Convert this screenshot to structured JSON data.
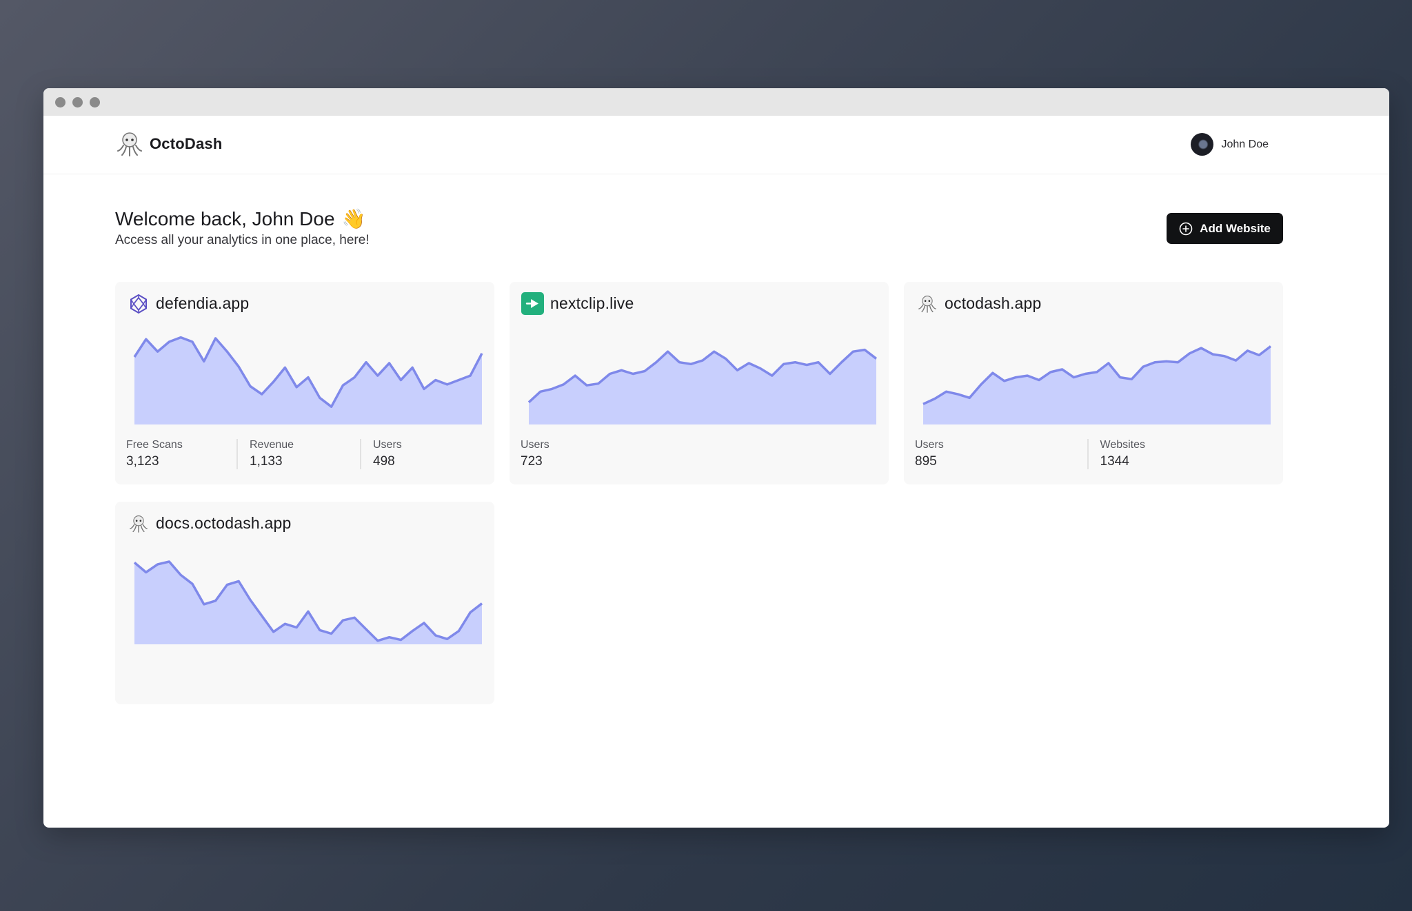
{
  "brand": {
    "name": "OctoDash",
    "logo_icon": "octopus-logo-icon"
  },
  "user": {
    "name": "John Doe"
  },
  "welcome": {
    "title": "Welcome back, John Doe",
    "emoji": "👋",
    "subtitle": "Access all your analytics in one place, here!"
  },
  "actions": {
    "add_website_label": "Add Website"
  },
  "colors": {
    "line": "#7f89ea",
    "fill": "#c8cffd",
    "card_bg": "#f8f8f8",
    "button_bg": "#111214"
  },
  "sites": [
    {
      "name": "defendia.app",
      "icon": "polyhedron-icon",
      "series": [
        0.76,
        0.96,
        0.82,
        0.93,
        0.98,
        0.93,
        0.71,
        0.97,
        0.82,
        0.65,
        0.43,
        0.34,
        0.48,
        0.64,
        0.42,
        0.53,
        0.3,
        0.2,
        0.44,
        0.53,
        0.7,
        0.55,
        0.69,
        0.5,
        0.64,
        0.4,
        0.5,
        0.45,
        0.5,
        0.55,
        0.8
      ],
      "stats": [
        {
          "label": "Free Scans",
          "value": "3,123"
        },
        {
          "label": "Revenue",
          "value": "1,133"
        },
        {
          "label": "Users",
          "value": "498"
        }
      ]
    },
    {
      "name": "nextclip.live",
      "icon": "play-tag-icon",
      "series": [
        0.25,
        0.37,
        0.4,
        0.45,
        0.55,
        0.44,
        0.46,
        0.57,
        0.61,
        0.57,
        0.6,
        0.7,
        0.82,
        0.7,
        0.68,
        0.72,
        0.82,
        0.74,
        0.61,
        0.69,
        0.63,
        0.55,
        0.68,
        0.7,
        0.67,
        0.7,
        0.57,
        0.7,
        0.82,
        0.84,
        0.74
      ],
      "stats": [
        {
          "label": "Users",
          "value": "723"
        }
      ]
    },
    {
      "name": "octodash.app",
      "icon": "octopus-icon",
      "series": [
        0.23,
        0.29,
        0.37,
        0.34,
        0.3,
        0.45,
        0.58,
        0.49,
        0.53,
        0.55,
        0.5,
        0.59,
        0.62,
        0.53,
        0.57,
        0.59,
        0.69,
        0.53,
        0.51,
        0.65,
        0.7,
        0.71,
        0.7,
        0.8,
        0.86,
        0.79,
        0.77,
        0.72,
        0.83,
        0.78,
        0.88
      ],
      "stats": [
        {
          "label": "Users",
          "value": "895"
        },
        {
          "label": "Websites",
          "value": "1344"
        }
      ]
    },
    {
      "name": "docs.octodash.app",
      "icon": "octopus-icon",
      "series": [
        0.92,
        0.81,
        0.9,
        0.93,
        0.78,
        0.68,
        0.45,
        0.49,
        0.67,
        0.71,
        0.5,
        0.32,
        0.14,
        0.23,
        0.19,
        0.37,
        0.16,
        0.12,
        0.27,
        0.3,
        0.17,
        0.04,
        0.08,
        0.05,
        0.15,
        0.24,
        0.1,
        0.06,
        0.15,
        0.36,
        0.46
      ]
    }
  ]
}
